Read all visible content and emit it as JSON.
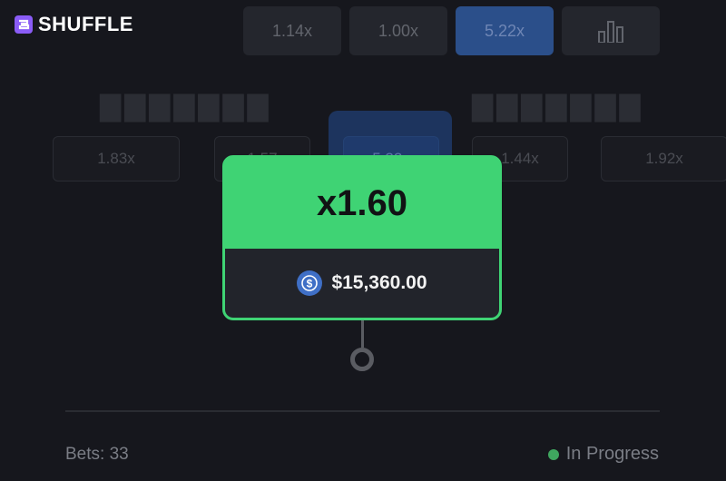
{
  "brand": {
    "name": "SHUFFLE",
    "color": "#8a5cf6"
  },
  "top_tabs": [
    {
      "label": "1.14x",
      "active": false
    },
    {
      "label": "1.00x",
      "active": false
    },
    {
      "label": "5.22x",
      "active": true
    },
    {
      "label": "",
      "icon": "bar-chart-icon",
      "active": false
    }
  ],
  "multiplier_row": [
    "1.83x",
    "1.57",
    "5.22x",
    "1.44x",
    "1.92x"
  ],
  "popup": {
    "multiplier": "x1.60",
    "amount": "$15,360.00",
    "currency_icon": "usdc-coin-icon",
    "accent": "#3fd374"
  },
  "footer": {
    "bets": "Bets: 33",
    "status": "In Progress",
    "status_color": "#3fa65f"
  }
}
